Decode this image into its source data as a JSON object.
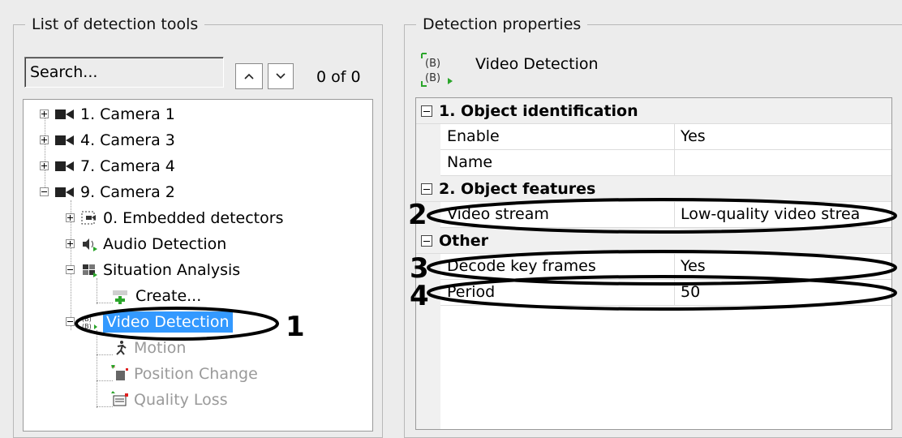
{
  "left_panel": {
    "title": "List of detection tools",
    "search_value": "Search...",
    "result_count": "0 of 0",
    "tree": [
      {
        "label": "1. Camera 1",
        "icon": "camera-icon"
      },
      {
        "label": "4. Camera 3",
        "icon": "camera-icon"
      },
      {
        "label": "7. Camera 4",
        "icon": "camera-icon"
      },
      {
        "label": "9. Camera 2",
        "icon": "camera-icon"
      },
      {
        "label": "0. Embedded detectors",
        "icon": "embedded-detector-icon"
      },
      {
        "label": "Audio Detection",
        "icon": "audio-detection-icon"
      },
      {
        "label": "Situation Analysis",
        "icon": "situation-analysis-icon"
      },
      {
        "label": "Create...",
        "icon": "create-icon"
      },
      {
        "label": "Video Detection",
        "icon": "video-detection-icon"
      },
      {
        "label": "Motion",
        "icon": "motion-icon"
      },
      {
        "label": "Position Change",
        "icon": "position-change-icon"
      },
      {
        "label": "Quality Loss",
        "icon": "quality-loss-icon"
      }
    ]
  },
  "right_panel": {
    "title": "Detection properties",
    "header_title": "Video Detection",
    "sections": [
      {
        "title": "1. Object identification",
        "rows": [
          {
            "name": "Enable",
            "value": "Yes"
          },
          {
            "name": "Name",
            "value": ""
          }
        ]
      },
      {
        "title": "2. Object features",
        "rows": [
          {
            "name": "Video stream",
            "value": "Low-quality video strea"
          }
        ]
      },
      {
        "title": "Other",
        "rows": [
          {
            "name": "Decode key frames",
            "value": "Yes"
          },
          {
            "name": "Period",
            "value": "50"
          }
        ]
      }
    ]
  },
  "callouts": [
    "1",
    "2",
    "3",
    "4"
  ],
  "colors": {
    "selection": "#3399ff",
    "detector_green": "#2aa52a",
    "detector_red": "#e02020"
  }
}
